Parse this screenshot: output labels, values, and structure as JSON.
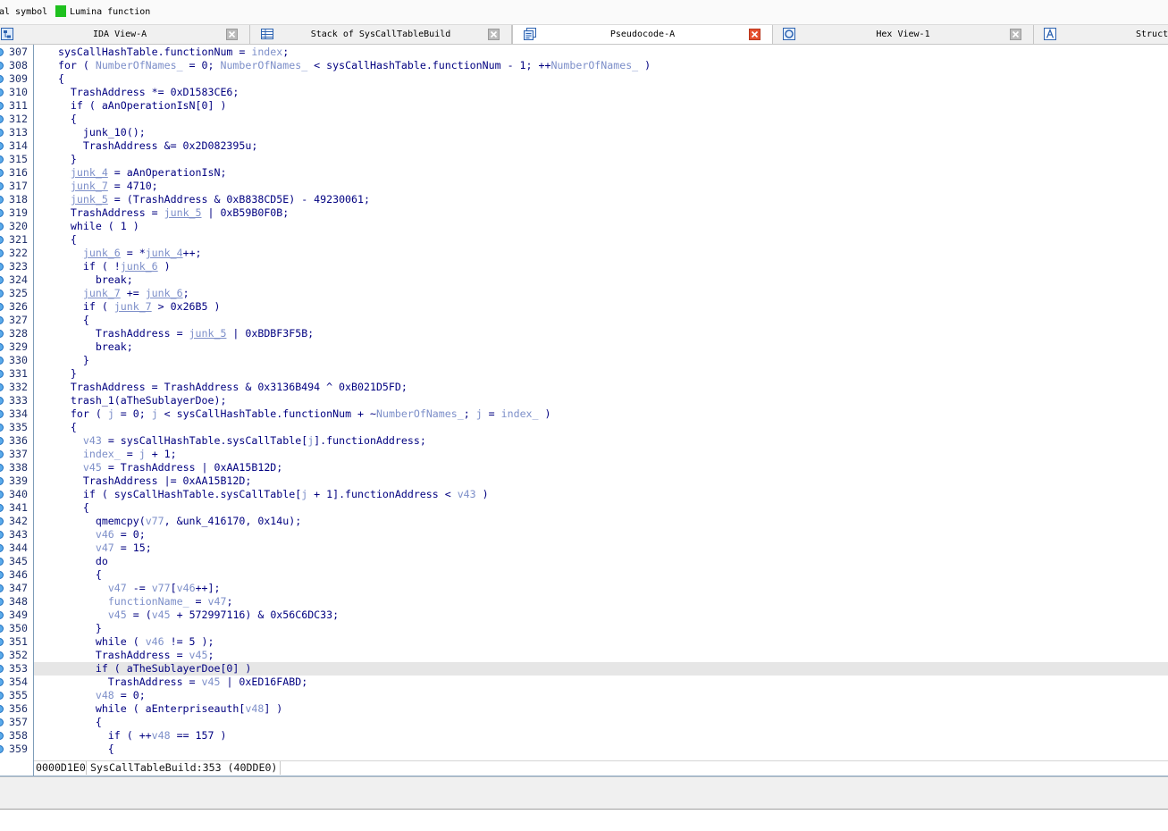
{
  "legend": {
    "clipped_label": "al symbol",
    "lumina_label": "Lumina function",
    "lumina_color": "#1fc11f"
  },
  "tabs": [
    {
      "label": "IDA View-A",
      "icon": "disassembly-view-icon",
      "active": false
    },
    {
      "label": "Stack of SysCallTableBuild",
      "icon": "stack-view-icon",
      "active": false
    },
    {
      "label": "Pseudocode-A",
      "icon": "pseudocode-view-icon",
      "active": true
    },
    {
      "label": "Hex View-1",
      "icon": "hex-view-icon",
      "active": false
    },
    {
      "label": "Struct",
      "icon": "structures-view-icon",
      "active": false
    }
  ],
  "colors": {
    "code_text": "#000080",
    "local_var": "#7d8fc9",
    "line_number": "#20306a",
    "current_line_bg": "#e6e6e6",
    "frame": "#7f9db9",
    "marker": "#1f6fc0",
    "close_active": "#e5502f",
    "close_inactive": "#bcbcbc"
  },
  "code": {
    "highlighted_line": 353,
    "lines": [
      {
        "n": "307",
        "s": [
          {
            "t": "  sysCallHashTable.functionNum = "
          },
          {
            "t": "index",
            "lv": true
          },
          {
            "t": ";"
          }
        ]
      },
      {
        "n": "308",
        "s": [
          {
            "t": "  for ( "
          },
          {
            "t": "NumberOfNames_",
            "lv": true
          },
          {
            "t": " = 0; "
          },
          {
            "t": "NumberOfNames_",
            "lv": true
          },
          {
            "t": " < sysCallHashTable.functionNum - 1; ++"
          },
          {
            "t": "NumberOfNames_",
            "lv": true
          },
          {
            "t": " )"
          }
        ]
      },
      {
        "n": "309",
        "s": [
          {
            "t": "  {"
          }
        ]
      },
      {
        "n": "310",
        "s": [
          {
            "t": "    TrashAddress *= 0xD1583CE6;"
          }
        ]
      },
      {
        "n": "311",
        "s": [
          {
            "t": "    if ( aAnOperationIsN[0] )"
          }
        ]
      },
      {
        "n": "312",
        "s": [
          {
            "t": "    {"
          }
        ]
      },
      {
        "n": "313",
        "s": [
          {
            "t": "      junk_10();"
          }
        ]
      },
      {
        "n": "314",
        "s": [
          {
            "t": "      TrashAddress &= 0x2D082395u;"
          }
        ]
      },
      {
        "n": "315",
        "s": [
          {
            "t": "    }"
          }
        ]
      },
      {
        "n": "316",
        "s": [
          {
            "t": "    "
          },
          {
            "t": "junk_4",
            "lv": true,
            "u": true
          },
          {
            "t": " = aAnOperationIsN;"
          }
        ]
      },
      {
        "n": "317",
        "s": [
          {
            "t": "    "
          },
          {
            "t": "junk_7",
            "lv": true,
            "u": true
          },
          {
            "t": " = 4710;"
          }
        ]
      },
      {
        "n": "318",
        "s": [
          {
            "t": "    "
          },
          {
            "t": "junk_5",
            "lv": true,
            "u": true
          },
          {
            "t": " = (TrashAddress & 0xB838CD5E) - 49230061;"
          }
        ]
      },
      {
        "n": "319",
        "s": [
          {
            "t": "    TrashAddress = "
          },
          {
            "t": "junk_5",
            "lv": true,
            "u": true
          },
          {
            "t": " | 0xB59B0F0B;"
          }
        ]
      },
      {
        "n": "320",
        "s": [
          {
            "t": "    while ( 1 )"
          }
        ]
      },
      {
        "n": "321",
        "s": [
          {
            "t": "    {"
          }
        ]
      },
      {
        "n": "322",
        "s": [
          {
            "t": "      "
          },
          {
            "t": "junk_6",
            "lv": true,
            "u": true
          },
          {
            "t": " = *"
          },
          {
            "t": "junk_4",
            "lv": true,
            "u": true
          },
          {
            "t": "++;"
          }
        ]
      },
      {
        "n": "323",
        "s": [
          {
            "t": "      if ( !"
          },
          {
            "t": "junk_6",
            "lv": true,
            "u": true
          },
          {
            "t": " )"
          }
        ]
      },
      {
        "n": "324",
        "s": [
          {
            "t": "        break;"
          }
        ]
      },
      {
        "n": "325",
        "s": [
          {
            "t": "      "
          },
          {
            "t": "junk_7",
            "lv": true,
            "u": true
          },
          {
            "t": " += "
          },
          {
            "t": "junk_6",
            "lv": true,
            "u": true
          },
          {
            "t": ";"
          }
        ]
      },
      {
        "n": "326",
        "s": [
          {
            "t": "      if ( "
          },
          {
            "t": "junk_7",
            "lv": true,
            "u": true
          },
          {
            "t": " > 0x26B5 )"
          }
        ]
      },
      {
        "n": "327",
        "s": [
          {
            "t": "      {"
          }
        ]
      },
      {
        "n": "328",
        "s": [
          {
            "t": "        TrashAddress = "
          },
          {
            "t": "junk_5",
            "lv": true,
            "u": true
          },
          {
            "t": " | 0xBDBF3F5B;"
          }
        ]
      },
      {
        "n": "329",
        "s": [
          {
            "t": "        break;"
          }
        ]
      },
      {
        "n": "330",
        "s": [
          {
            "t": "      }"
          }
        ]
      },
      {
        "n": "331",
        "s": [
          {
            "t": "    }"
          }
        ]
      },
      {
        "n": "332",
        "s": [
          {
            "t": "    TrashAddress = TrashAddress & 0x3136B494 ^ 0xB021D5FD;"
          }
        ]
      },
      {
        "n": "333",
        "s": [
          {
            "t": "    trash_1(aTheSublayerDoe);"
          }
        ]
      },
      {
        "n": "334",
        "s": [
          {
            "t": "    for ( "
          },
          {
            "t": "j",
            "lv": true
          },
          {
            "t": " = 0; "
          },
          {
            "t": "j",
            "lv": true
          },
          {
            "t": " < sysCallHashTable.functionNum + ~"
          },
          {
            "t": "NumberOfNames_",
            "lv": true
          },
          {
            "t": "; "
          },
          {
            "t": "j",
            "lv": true
          },
          {
            "t": " = "
          },
          {
            "t": "index_",
            "lv": true
          },
          {
            "t": " )"
          }
        ]
      },
      {
        "n": "335",
        "s": [
          {
            "t": "    {"
          }
        ]
      },
      {
        "n": "336",
        "s": [
          {
            "t": "      "
          },
          {
            "t": "v43",
            "lv": true
          },
          {
            "t": " = sysCallHashTable.sysCallTable["
          },
          {
            "t": "j",
            "lv": true
          },
          {
            "t": "].functionAddress;"
          }
        ]
      },
      {
        "n": "337",
        "s": [
          {
            "t": "      "
          },
          {
            "t": "index_",
            "lv": true
          },
          {
            "t": " = "
          },
          {
            "t": "j",
            "lv": true
          },
          {
            "t": " + 1;"
          }
        ]
      },
      {
        "n": "338",
        "s": [
          {
            "t": "      "
          },
          {
            "t": "v45",
            "lv": true
          },
          {
            "t": " = TrashAddress | 0xAA15B12D;"
          }
        ]
      },
      {
        "n": "339",
        "s": [
          {
            "t": "      TrashAddress |= 0xAA15B12D;"
          }
        ]
      },
      {
        "n": "340",
        "s": [
          {
            "t": "      if ( sysCallHashTable.sysCallTable["
          },
          {
            "t": "j",
            "lv": true
          },
          {
            "t": " + 1].functionAddress < "
          },
          {
            "t": "v43",
            "lv": true
          },
          {
            "t": " )"
          }
        ]
      },
      {
        "n": "341",
        "s": [
          {
            "t": "      {"
          }
        ]
      },
      {
        "n": "342",
        "s": [
          {
            "t": "        qmemcpy("
          },
          {
            "t": "v77",
            "lv": true
          },
          {
            "t": ", &unk_416170, 0x14u);"
          }
        ]
      },
      {
        "n": "343",
        "s": [
          {
            "t": "        "
          },
          {
            "t": "v46",
            "lv": true
          },
          {
            "t": " = 0;"
          }
        ]
      },
      {
        "n": "344",
        "s": [
          {
            "t": "        "
          },
          {
            "t": "v47",
            "lv": true
          },
          {
            "t": " = 15;"
          }
        ]
      },
      {
        "n": "345",
        "s": [
          {
            "t": "        do"
          }
        ]
      },
      {
        "n": "346",
        "s": [
          {
            "t": "        {"
          }
        ]
      },
      {
        "n": "347",
        "s": [
          {
            "t": "          "
          },
          {
            "t": "v47",
            "lv": true
          },
          {
            "t": " -= "
          },
          {
            "t": "v77",
            "lv": true
          },
          {
            "t": "["
          },
          {
            "t": "v46",
            "lv": true
          },
          {
            "t": "++];"
          }
        ]
      },
      {
        "n": "348",
        "s": [
          {
            "t": "          "
          },
          {
            "t": "functionName_",
            "lv": true
          },
          {
            "t": " = "
          },
          {
            "t": "v47",
            "lv": true
          },
          {
            "t": ";"
          }
        ]
      },
      {
        "n": "349",
        "s": [
          {
            "t": "          "
          },
          {
            "t": "v45",
            "lv": true
          },
          {
            "t": " = ("
          },
          {
            "t": "v45",
            "lv": true
          },
          {
            "t": " + 572997116) & 0x56C6DC33;"
          }
        ]
      },
      {
        "n": "350",
        "s": [
          {
            "t": "        }"
          }
        ]
      },
      {
        "n": "351",
        "s": [
          {
            "t": "        while ( "
          },
          {
            "t": "v46",
            "lv": true
          },
          {
            "t": " != 5 );"
          }
        ]
      },
      {
        "n": "352",
        "s": [
          {
            "t": "        TrashAddress = "
          },
          {
            "t": "v45",
            "lv": true
          },
          {
            "t": ";"
          }
        ]
      },
      {
        "n": "353",
        "s": [
          {
            "t": "        if ( aTheSublayerDoe[0] )"
          }
        ]
      },
      {
        "n": "354",
        "s": [
          {
            "t": "          TrashAddress = "
          },
          {
            "t": "v45",
            "lv": true
          },
          {
            "t": " | 0xED16FABD;"
          }
        ]
      },
      {
        "n": "355",
        "s": [
          {
            "t": "        "
          },
          {
            "t": "v48",
            "lv": true
          },
          {
            "t": " = 0;"
          }
        ]
      },
      {
        "n": "356",
        "s": [
          {
            "t": "        while ( aEnterpriseauth["
          },
          {
            "t": "v48",
            "lv": true
          },
          {
            "t": "] )"
          }
        ]
      },
      {
        "n": "357",
        "s": [
          {
            "t": "        {"
          }
        ]
      },
      {
        "n": "358",
        "s": [
          {
            "t": "          if ( ++"
          },
          {
            "t": "v48",
            "lv": true
          },
          {
            "t": " == 157 )"
          }
        ]
      },
      {
        "n": "359",
        "s": [
          {
            "t": "          {"
          }
        ]
      }
    ]
  },
  "status": {
    "address": "0000D1E0",
    "location": "SysCallTableBuild:353 (40DDE0)"
  }
}
